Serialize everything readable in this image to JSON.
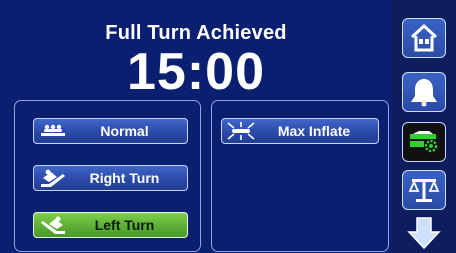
{
  "header": {
    "title": "Full Turn Achieved",
    "timer": "15:00"
  },
  "positions": {
    "items": [
      {
        "label": "Normal",
        "icon": "bed-flat-icon",
        "active": false
      },
      {
        "label": "Right Turn",
        "icon": "bed-right-turn-icon",
        "active": false
      },
      {
        "label": "Left Turn",
        "icon": "bed-left-turn-icon",
        "active": true
      }
    ]
  },
  "modes": {
    "max_inflate_label": "Max Inflate",
    "max_inflate_icon": "max-inflate-icon"
  },
  "sidebar": {
    "items": [
      {
        "name": "home",
        "icon": "home-icon"
      },
      {
        "name": "alarm",
        "icon": "bell-icon"
      },
      {
        "name": "therapy",
        "icon": "mattress-gear-icon"
      },
      {
        "name": "scale",
        "icon": "scale-icon"
      },
      {
        "name": "scroll-down",
        "icon": "arrow-down-icon"
      }
    ]
  },
  "colors": {
    "background": "#0c1f70",
    "button": "#2f52b0",
    "active_button": "#67b43d",
    "active_icon_green": "#2ed12e",
    "panel_border": "#8fa6e0"
  }
}
